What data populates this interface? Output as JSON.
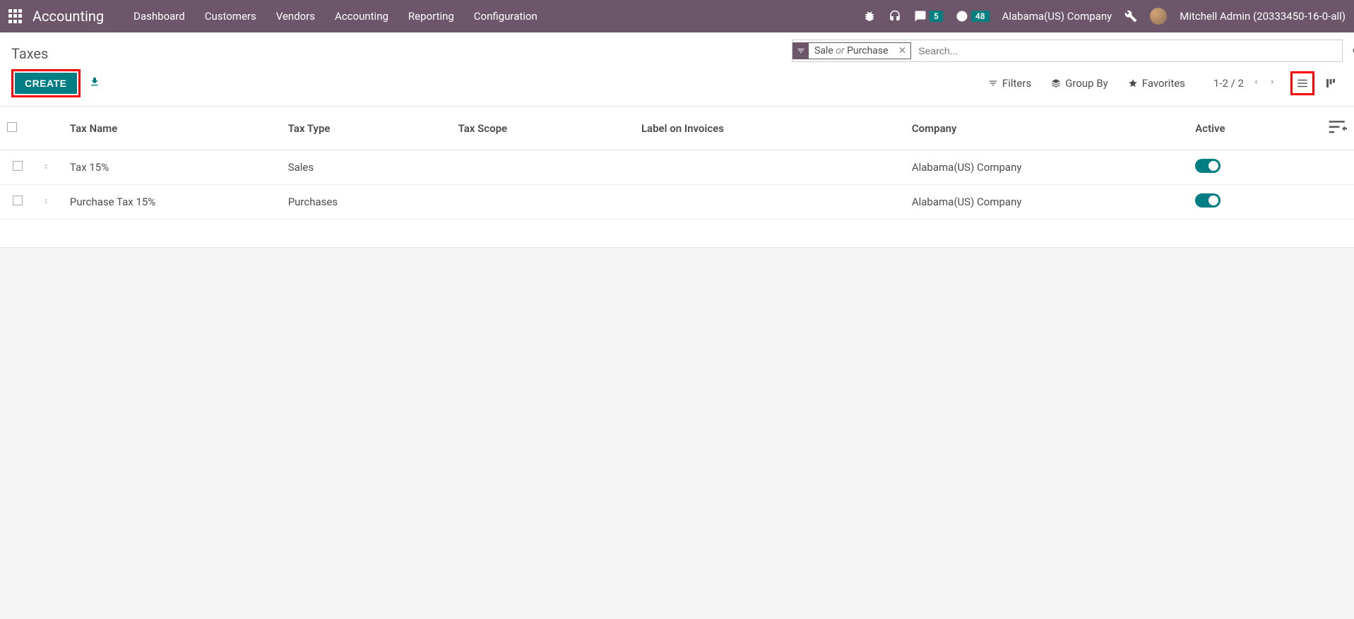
{
  "nav": {
    "brand": "Accounting",
    "items": [
      "Dashboard",
      "Customers",
      "Vendors",
      "Accounting",
      "Reporting",
      "Configuration"
    ],
    "messages_badge": "5",
    "activities_badge": "48",
    "company": "Alabama(US) Company",
    "user": "Mitchell Admin (20333450-16-0-all)"
  },
  "breadcrumb": {
    "title": "Taxes"
  },
  "search": {
    "facet_parts": {
      "a": "Sale",
      "or": "or",
      "b": "Purchase"
    },
    "placeholder": "Search..."
  },
  "buttons": {
    "create": "CREATE"
  },
  "facet_buttons": {
    "filters": "Filters",
    "groupby": "Group By",
    "favorites": "Favorites"
  },
  "pager": {
    "range": "1-2 / 2"
  },
  "table": {
    "headers": {
      "name": "Tax Name",
      "type": "Tax Type",
      "scope": "Tax Scope",
      "label": "Label on Invoices",
      "company": "Company",
      "active": "Active"
    },
    "rows": [
      {
        "name": "Tax 15%",
        "type": "Sales",
        "scope": "",
        "label": "",
        "company": "Alabama(US) Company",
        "active": true
      },
      {
        "name": "Purchase Tax 15%",
        "type": "Purchases",
        "scope": "",
        "label": "",
        "company": "Alabama(US) Company",
        "active": true
      }
    ]
  }
}
